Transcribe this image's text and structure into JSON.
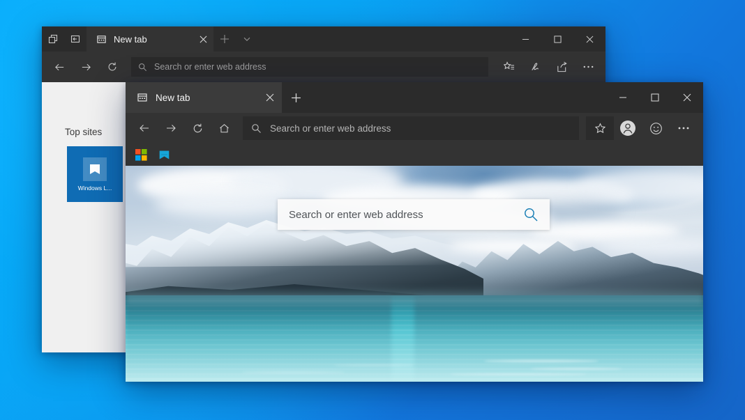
{
  "desktop": {
    "wallpaper_top_color": "#0aa5f5",
    "wallpaper_bottom_color": "#1565c8"
  },
  "back_window": {
    "name": "Microsoft Edge (background window)",
    "tab_tools": [
      {
        "name": "set-tabs-aside-icon",
        "label": "Set these tabs aside"
      },
      {
        "name": "tabs-you-set-aside-icon",
        "label": "Tabs you've set aside"
      }
    ],
    "tab": {
      "title": "New tab",
      "favicon": "new-tab-icon",
      "close_label": "Close tab"
    },
    "new_tab_label": "New tab",
    "tab_menu_label": "Tab options",
    "window_controls": {
      "minimize": "Minimize",
      "maximize": "Maximize",
      "close": "Close"
    },
    "nav": {
      "back": "Back",
      "forward": "Forward",
      "refresh": "Refresh"
    },
    "address_bar": {
      "placeholder": "Search or enter web address",
      "value": "",
      "icon": "search-icon"
    },
    "toolbar_icons": [
      {
        "name": "favorites-hub-icon",
        "label": "Favorites, reading list, history and downloads"
      },
      {
        "name": "make-a-note-icon",
        "label": "Make a Web Note"
      },
      {
        "name": "share-icon",
        "label": "Share this page"
      },
      {
        "name": "settings-more-icon",
        "label": "Settings and more"
      }
    ],
    "new_tab_page": {
      "top_sites_label": "Top sites",
      "tiles": [
        {
          "label": "Windows L...",
          "icon": "windows-live-icon",
          "color": "#0f6cb4"
        }
      ]
    }
  },
  "front_window": {
    "name": "Microsoft Edge (foreground window)",
    "tab": {
      "title": "New tab",
      "favicon": "new-tab-icon",
      "close_label": "Close tab"
    },
    "new_tab_label": "New tab",
    "window_controls": {
      "minimize": "Minimize",
      "maximize": "Maximize",
      "close": "Close"
    },
    "nav": {
      "back": "Back",
      "forward": "Forward",
      "refresh": "Refresh",
      "home": "Home"
    },
    "address_bar": {
      "placeholder": "Search or enter web address",
      "value": "",
      "icon": "search-icon"
    },
    "toolbar_icons": [
      {
        "name": "favorites-star-icon",
        "label": "Add to favorites or reading list"
      },
      {
        "name": "profile-avatar-icon",
        "label": "Profile"
      },
      {
        "name": "feedback-smiley-icon",
        "label": "Send feedback"
      },
      {
        "name": "settings-more-icon",
        "label": "Settings and more"
      }
    ],
    "favorites_bar": [
      {
        "name": "microsoft-logo-icon",
        "label": "Microsoft"
      },
      {
        "name": "windows-live-icon",
        "label": "Windows Live"
      }
    ],
    "new_tab_page": {
      "search_box": {
        "placeholder": "Search or enter web address",
        "value": "",
        "icon": "search-icon",
        "icon_color": "#1a7fb5"
      },
      "background": "mountain-lake-photo"
    }
  }
}
